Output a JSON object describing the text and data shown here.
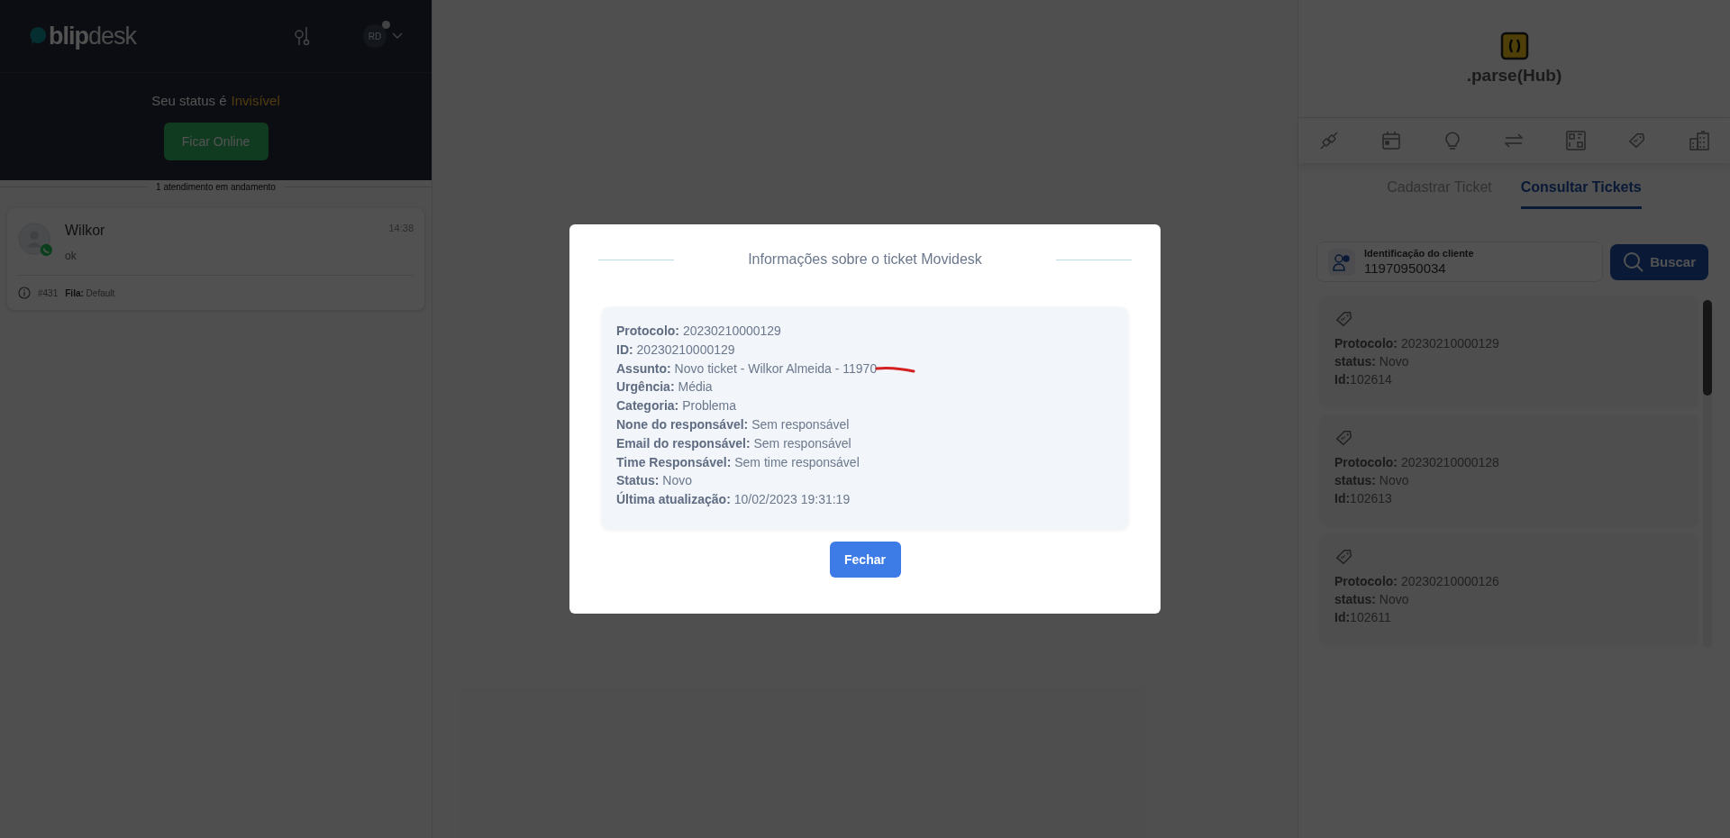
{
  "sidebar": {
    "logo": "**blip**desk",
    "avatar_initials": "RD",
    "status_text": "Seu status é",
    "status_value": "Invisível",
    "online_button": "Ficar Online",
    "queue_label": "1 atendimento em andamento",
    "conversations": [
      {
        "name": "Wilkor",
        "time": "14:38",
        "message": "ok",
        "ticket": "#431",
        "queue_label": "Fila:",
        "queue": "Default"
      }
    ]
  },
  "modal": {
    "title": "Informações sobre o ticket Movidesk",
    "fields": [
      {
        "label": "Protocolo:",
        "value": "20230210000129"
      },
      {
        "label": "ID:",
        "value": "20230210000129"
      },
      {
        "label": "Assunto:",
        "value": "Novo ticket - Wilkor Almeida - 11970",
        "redacted": true
      },
      {
        "label": "Urgência:",
        "value": "Média"
      },
      {
        "label": "Categoria:",
        "value": "Problema"
      },
      {
        "label": "None do responsável:",
        "value": "Sem responsável"
      },
      {
        "label": "Email do responsável:",
        "value": "Sem responsável"
      },
      {
        "label": "Time Responsável:",
        "value": "Sem time responsável"
      },
      {
        "label": "Status:",
        "value": "Novo"
      },
      {
        "label": "Última atualização:",
        "value": "10/02/2023 19:31:19"
      }
    ],
    "close_button": "Fechar"
  },
  "plugin": {
    "name": ".parse(Hub)",
    "tabs": [
      {
        "label": "Cadastrar Ticket",
        "selected": false
      },
      {
        "label": "Consultar Tickets",
        "selected": true
      }
    ],
    "search": {
      "label": "Identificação do cliente",
      "value": "11970950034"
    },
    "search_button": "Buscar",
    "tickets": [
      {
        "protocol_label": "Protocolo:",
        "protocol": "20230210000129",
        "status_label": "status:",
        "status": "Novo",
        "id_label": "Id:",
        "id": "102614"
      },
      {
        "protocol_label": "Protocolo:",
        "protocol": "20230210000128",
        "status_label": "status:",
        "status": "Novo",
        "id_label": "Id:",
        "id": "102613"
      },
      {
        "protocol_label": "Protocolo:",
        "protocol": "20230210000126",
        "status_label": "status:",
        "status": "Novo",
        "id_label": "Id:",
        "id": "102611"
      }
    ]
  }
}
